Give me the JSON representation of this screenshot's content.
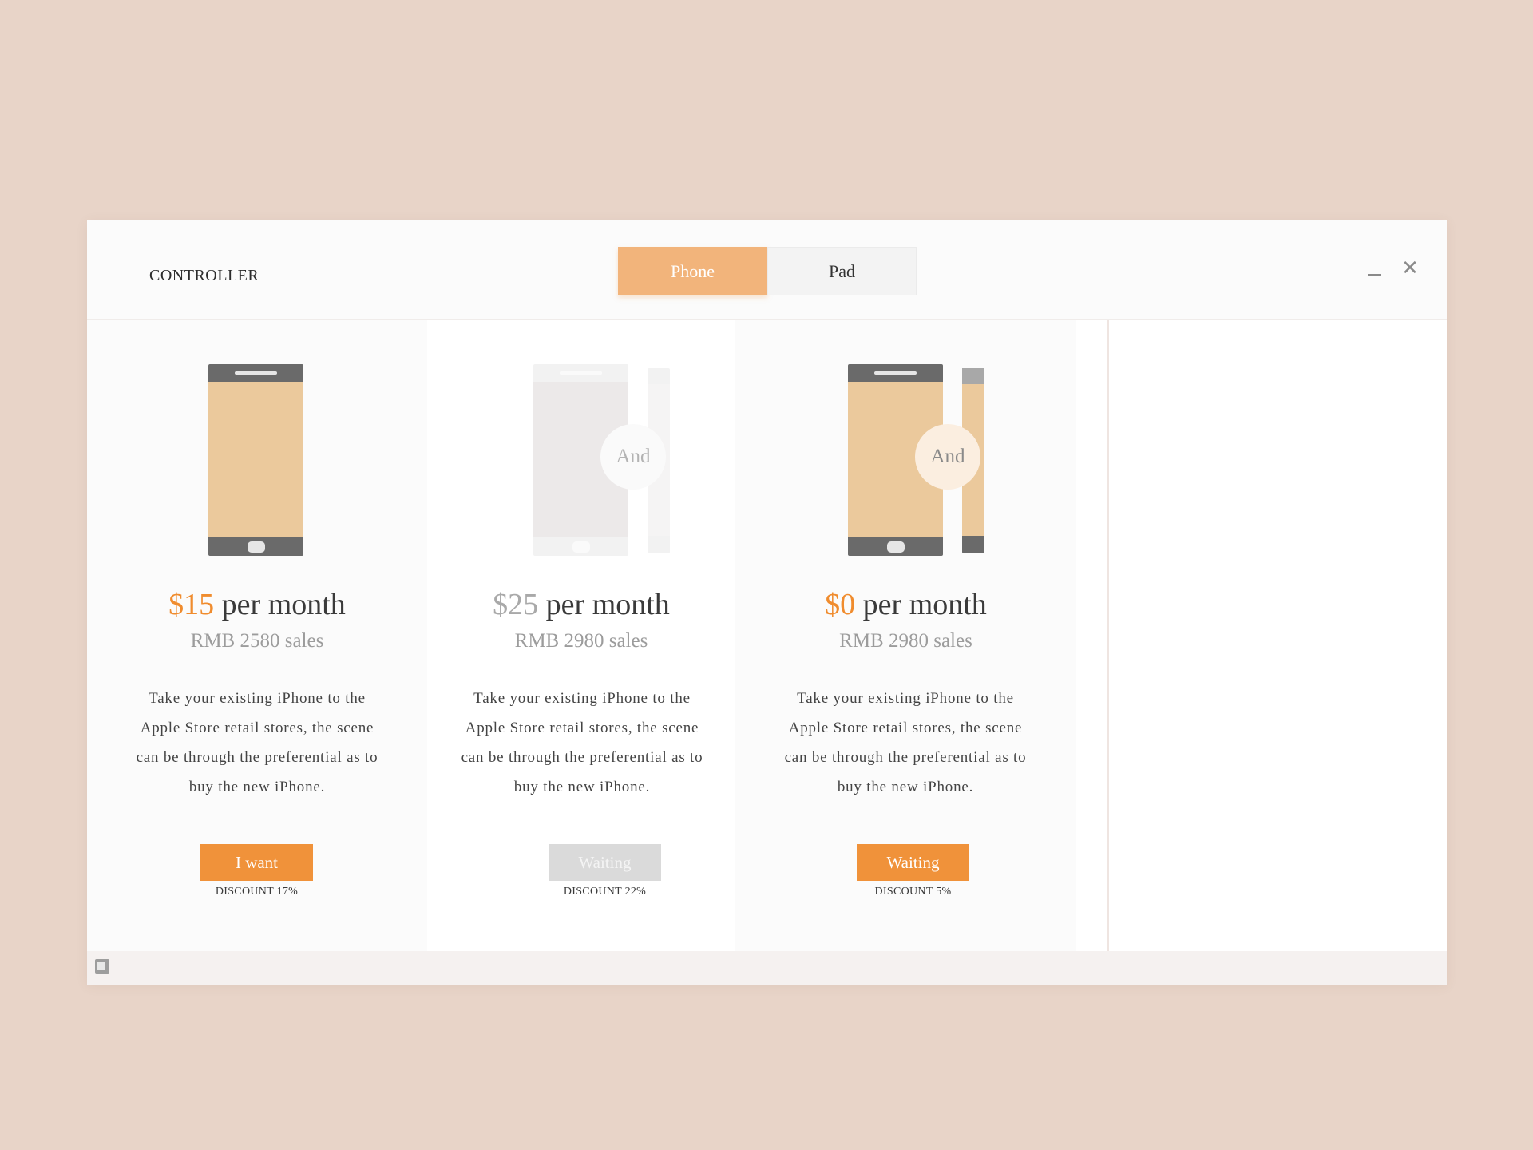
{
  "app": {
    "title": "CONTROLLER"
  },
  "tabs": [
    {
      "label": "Phone",
      "active": true
    },
    {
      "label": "Pad",
      "active": false
    }
  ],
  "window_controls": {
    "minimize_icon": "minimize-icon",
    "close_icon": "close-icon",
    "close_glyph": "✕"
  },
  "colors": {
    "background": "#e8d4c8",
    "accent": "#f0923a",
    "tab_active": "#f2b47b",
    "device_screen": "#ebc99c",
    "device_frame": "#6a6a6a",
    "disabled": "#dadada"
  },
  "plans": [
    {
      "price": "$15",
      "price_suffix": "per month",
      "sales": "RMB 2580 sales",
      "desc_lines": [
        "Take your existing iPhone to the",
        "Apple Store retail stores, the scene",
        "can be through the preferential as to",
        "buy the new iPhone."
      ],
      "button": "I want",
      "button_state": "active",
      "discount": "DISCOUNT 17%"
    },
    {
      "price": "$25",
      "price_suffix": "per month",
      "and": "And",
      "sales": "RMB 2980 sales",
      "desc_lines": [
        "Take your existing iPhone to the",
        "Apple Store retail stores, the scene",
        "can be through the preferential as to",
        "buy the new iPhone."
      ],
      "button": "Waiting",
      "button_state": "disabled",
      "discount": "DISCOUNT 22%"
    },
    {
      "price": "$0",
      "price_suffix": "per month",
      "and": "And",
      "sales": "RMB 2980 sales",
      "desc_lines": [
        "Take your existing iPhone to the",
        "Apple Store retail stores, the scene",
        "can be through the preferential as to",
        "buy the new iPhone."
      ],
      "button": "Waiting",
      "button_state": "active",
      "discount": "DISCOUNT 5%"
    }
  ]
}
